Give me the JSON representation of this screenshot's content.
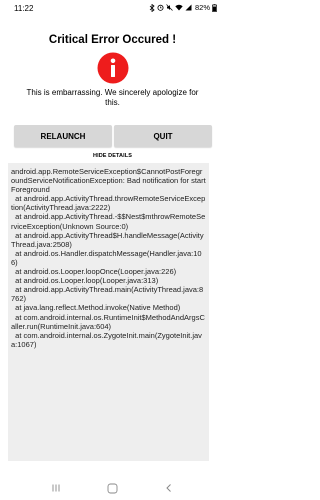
{
  "status_bar": {
    "time": "11:22",
    "battery": "82%",
    "icons": [
      "signal-icon",
      "bluetooth-icon",
      "alarm-icon",
      "mute-icon",
      "wifi-icon",
      "cell-signal-icon",
      "battery-icon"
    ]
  },
  "dialog": {
    "title": "Critical Error Occured !",
    "icon": "error-info-icon",
    "icon_color": "#ee1c1c",
    "message": "This is embarrassing. We sincerely apologize for this.",
    "relaunch_label": "RELAUNCH",
    "quit_label": "QUIT",
    "hide_details_label": "HIDE DETAILS"
  },
  "stack_trace": [
    "android.app.RemoteServiceException$CannotPostForegroundServiceNotificationException: Bad notification for startForeground",
    "  at android.app.ActivityThread.throwRemoteServiceException(ActivityThread.java:2222)",
    "  at android.app.ActivityThread.-$$Nest$mthrowRemoteServiceException(Unknown Source:0)",
    "  at android.app.ActivityThread$H.handleMessage(ActivityThread.java:2508)",
    "  at android.os.Handler.dispatchMessage(Handler.java:106)",
    "  at android.os.Looper.loopOnce(Looper.java:226)",
    "  at android.os.Looper.loop(Looper.java:313)",
    "  at android.app.ActivityThread.main(ActivityThread.java:8762)",
    "  at java.lang.reflect.Method.invoke(Native Method)",
    "  at com.android.internal.os.RuntimeInit$MethodAndArgsCaller.run(RuntimeInit.java:604)",
    "  at com.android.internal.os.ZygoteInit.main(ZygoteInit.java:1067)"
  ],
  "nav_bar": {
    "icons": [
      "recents-icon",
      "home-icon",
      "back-icon"
    ]
  }
}
